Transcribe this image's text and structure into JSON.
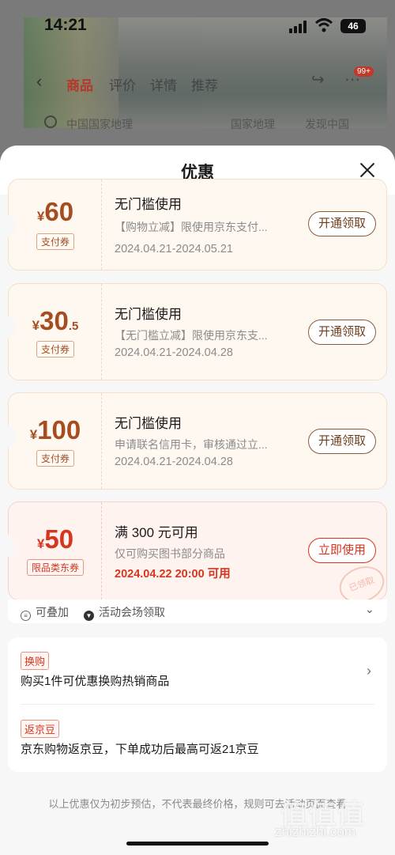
{
  "status_bar": {
    "time": "14:21",
    "battery": "46"
  },
  "background_page": {
    "tabs": [
      "商品",
      "评价",
      "详情",
      "推荐"
    ],
    "active_tab": "商品",
    "notification_badge": "99+",
    "search": {
      "query": "中国国家地理",
      "tags": [
        "国家地理",
        "发现中国"
      ]
    }
  },
  "sheet": {
    "title": "优惠",
    "coupons": [
      {
        "currency": "¥",
        "amount": "60",
        "decimal": "",
        "type_tag": "支付券",
        "title": "无门槛使用",
        "desc": "【购物立减】限使用京东支付...",
        "date": "2024.04.21-2024.05.21",
        "button": "开通领取"
      },
      {
        "currency": "¥",
        "amount": "30",
        "decimal": ".5",
        "type_tag": "支付券",
        "title": "无门槛使用",
        "desc": "【无门槛立减】限使用京东支...",
        "date": "2024.04.21-2024.04.28",
        "button": "开通领取"
      },
      {
        "currency": "¥",
        "amount": "100",
        "decimal": "",
        "type_tag": "支付券",
        "title": "无门槛使用",
        "desc": "申请联名信用卡，审核通过立...",
        "date": "2024.04.21-2024.04.28",
        "button": "开通领取"
      },
      {
        "currency": "¥",
        "amount": "50",
        "decimal": "",
        "type_tag": "限品类东券",
        "title": "满 300 元可用",
        "desc": "仅可购买图书部分商品",
        "date": "2024.04.22 20:00 可用",
        "button": "立即使用",
        "stamp": "已领取"
      }
    ],
    "legend": {
      "stackable": "可叠加",
      "venue": "活动会场领取"
    },
    "offers": [
      {
        "tag": "换购",
        "text": "购买1件可优惠换购热销商品"
      },
      {
        "tag": "返京豆",
        "text": "京东购物返京豆，下单成功后最高可返21京豆"
      }
    ],
    "footnote": "以上优惠仅为初步预估，不代表最终价格，规则可去活动页面查看",
    "watermark": {
      "logo": "值值值",
      "url": "zhizhizhi.com"
    }
  },
  "colors": {
    "accent_red": "#d6351e",
    "coupon_brown": "#a54d21",
    "coupon_bg": "#fff8f1"
  }
}
